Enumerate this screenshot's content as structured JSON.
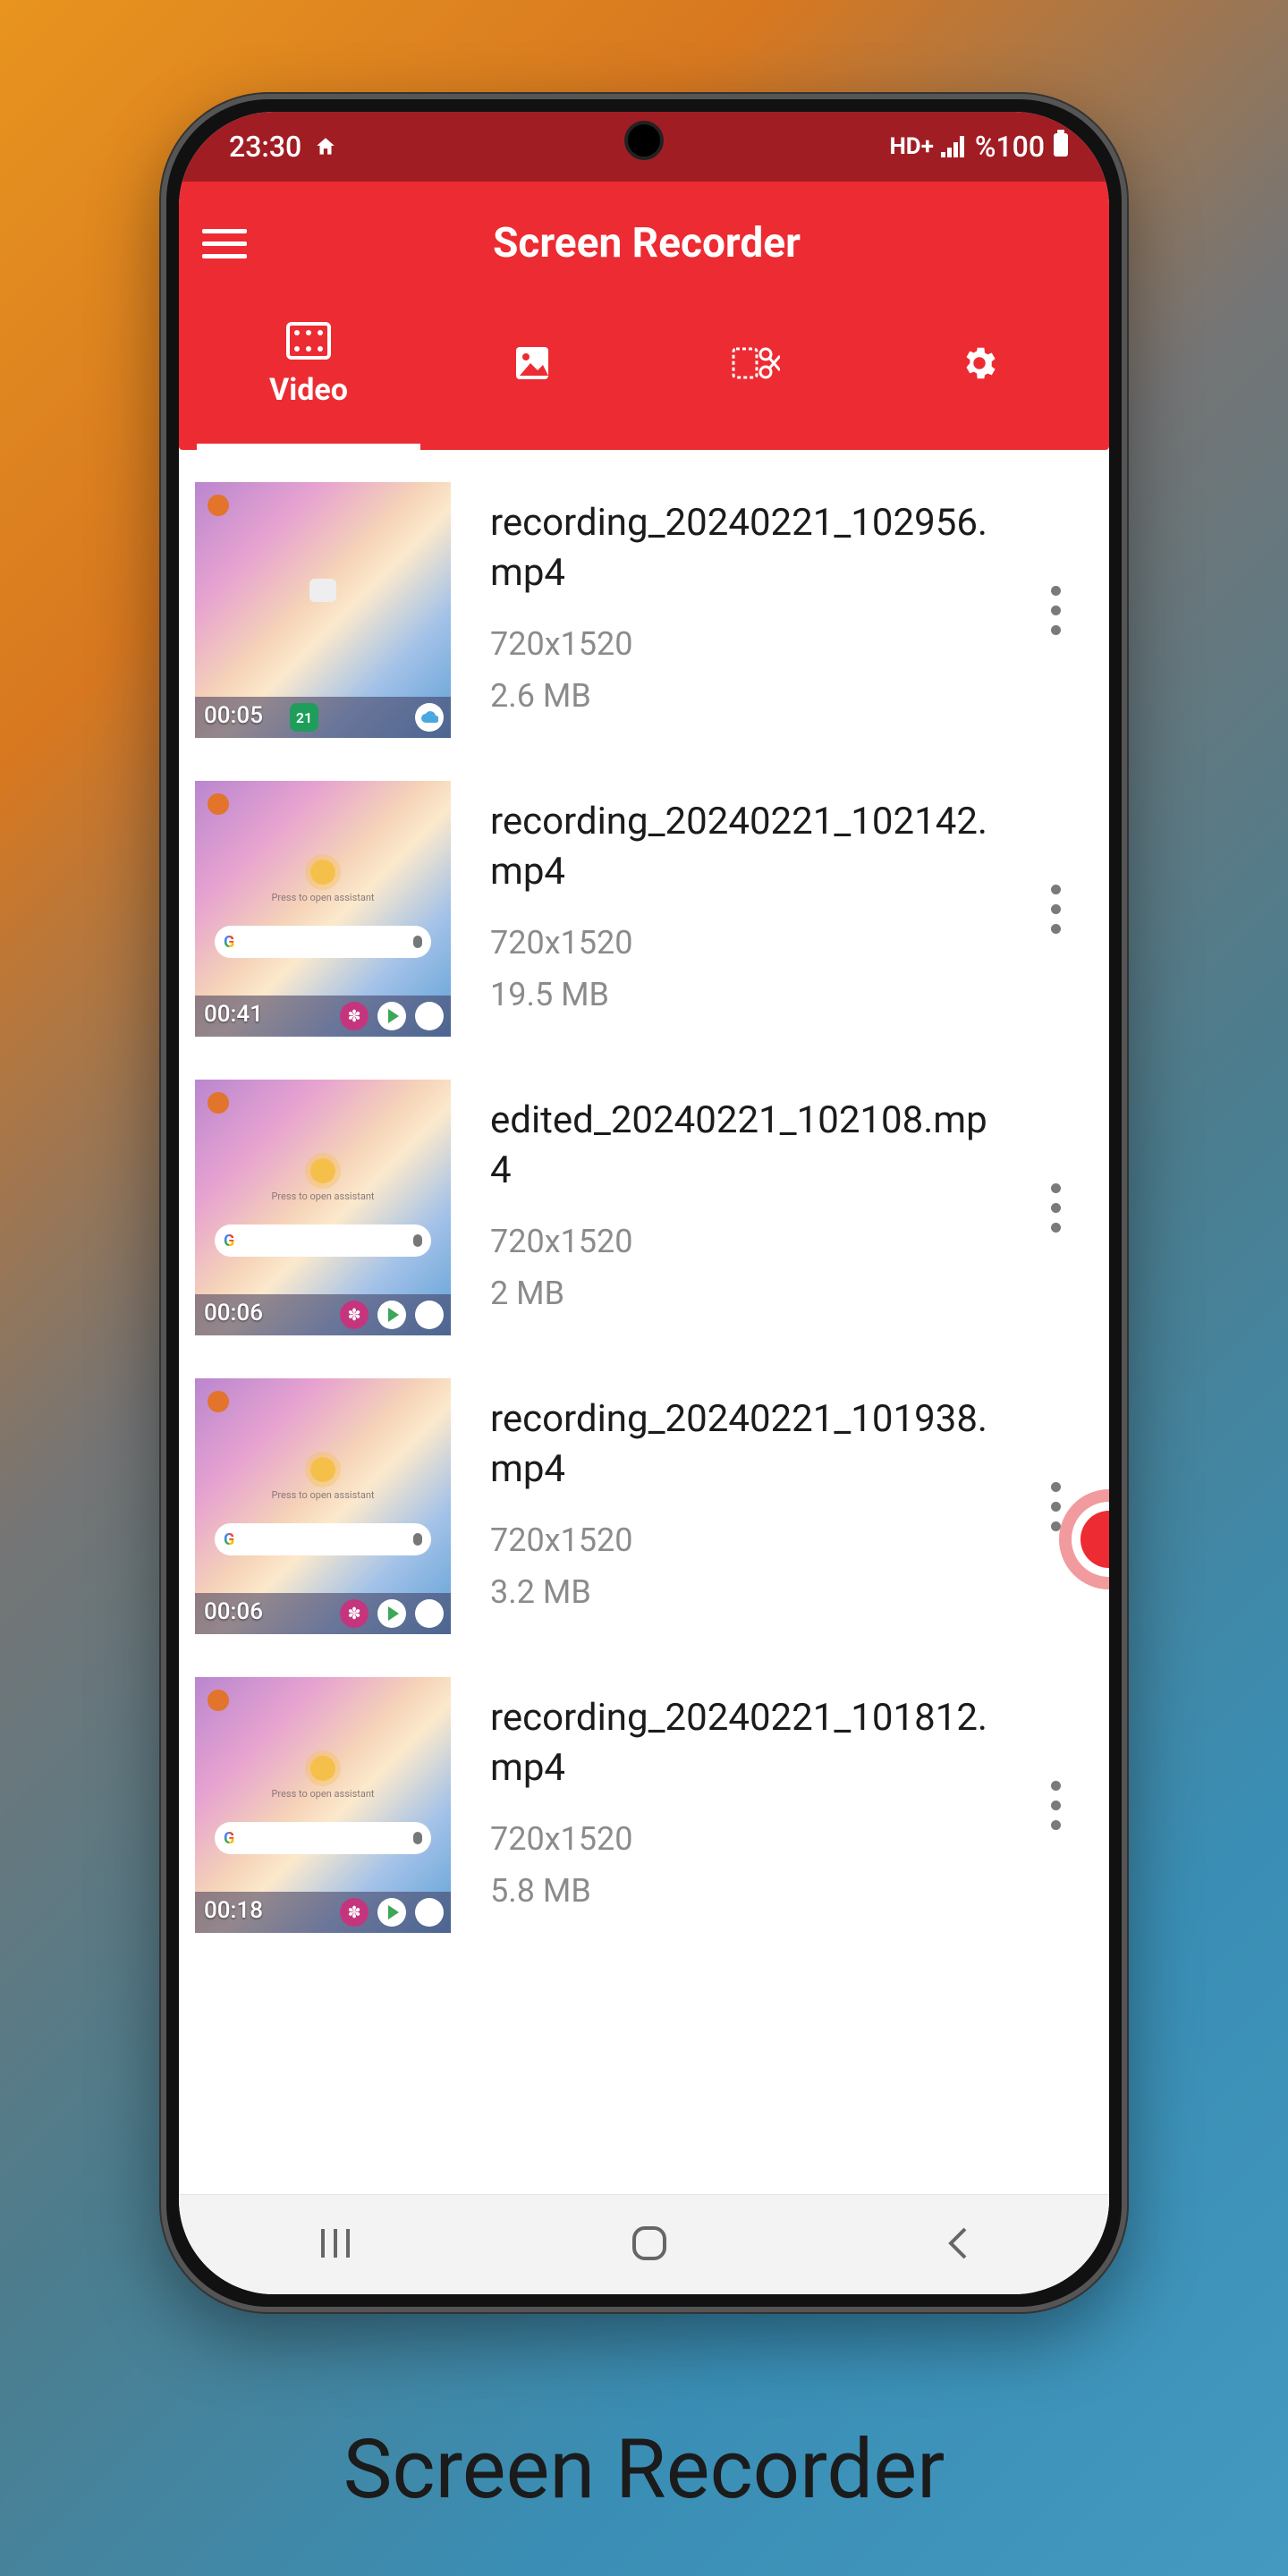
{
  "caption": "Screen Recorder",
  "statusbar": {
    "time": "23:30",
    "net": "HD+",
    "battery": "%100"
  },
  "app": {
    "title": "Screen Recorder",
    "tabs": {
      "video": "Video"
    }
  },
  "recordings": [
    {
      "filename": "recording_20240221_102956.mp4",
      "resolution": "720x1520",
      "size": "2.6 MB",
      "duration": "00:05",
      "variant": "a"
    },
    {
      "filename": "recording_20240221_102142.mp4",
      "resolution": "720x1520",
      "size": "19.5 MB",
      "duration": "00:41",
      "variant": "b"
    },
    {
      "filename": "edited_20240221_102108.mp4",
      "resolution": "720x1520",
      "size": "2 MB",
      "duration": "00:06",
      "variant": "b"
    },
    {
      "filename": "recording_20240221_101938.mp4",
      "resolution": "720x1520",
      "size": "3.2 MB",
      "duration": "00:06",
      "variant": "b"
    },
    {
      "filename": "recording_20240221_101812.mp4",
      "resolution": "720x1520",
      "size": "5.8 MB",
      "duration": "00:18",
      "variant": "b"
    }
  ]
}
